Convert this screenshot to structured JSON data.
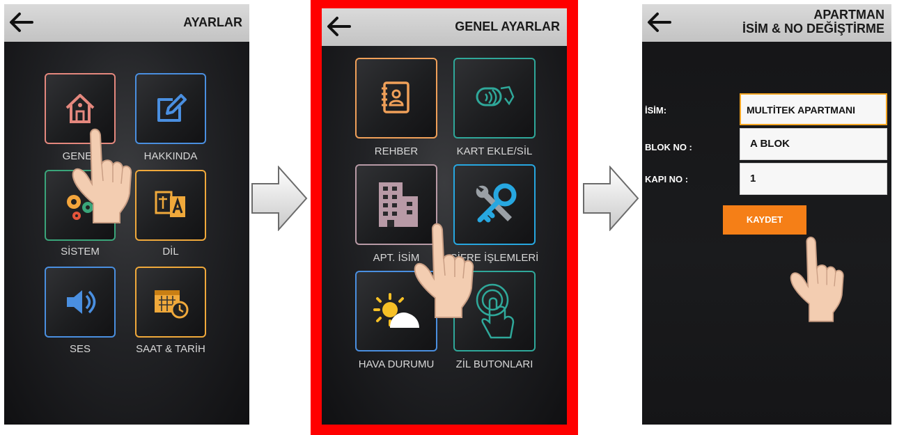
{
  "screen1": {
    "title": "AYARLAR",
    "tiles": [
      "GENEL",
      "HAKKINDA",
      "SİSTEM",
      "DİL",
      "SES",
      "SAAT & TARİH"
    ]
  },
  "screen2": {
    "title": "GENEL AYARLAR",
    "tiles": [
      "REHBER",
      "KART EKLE/SİL",
      "APT. İSİM",
      "ŞİFRE İŞLEMLERİ",
      "HAVA DURUMU",
      "ZİL BUTONLARI"
    ]
  },
  "screen3": {
    "title_line1": "APARTMAN",
    "title_line2": "İSİM & NO DEĞİŞTİRME",
    "name_label": "İSİM:",
    "name_value": "MULTİTEK APARTMANI",
    "block_label": "BLOK NO :",
    "block_value": "A BLOK",
    "door_label": "KAPI NO :",
    "door_value": "1",
    "save_label": "KAYDET"
  },
  "colors": {
    "highlight_frame": "#ff0000",
    "save_button": "#f57f17",
    "active_field_border": "#f5a623"
  }
}
